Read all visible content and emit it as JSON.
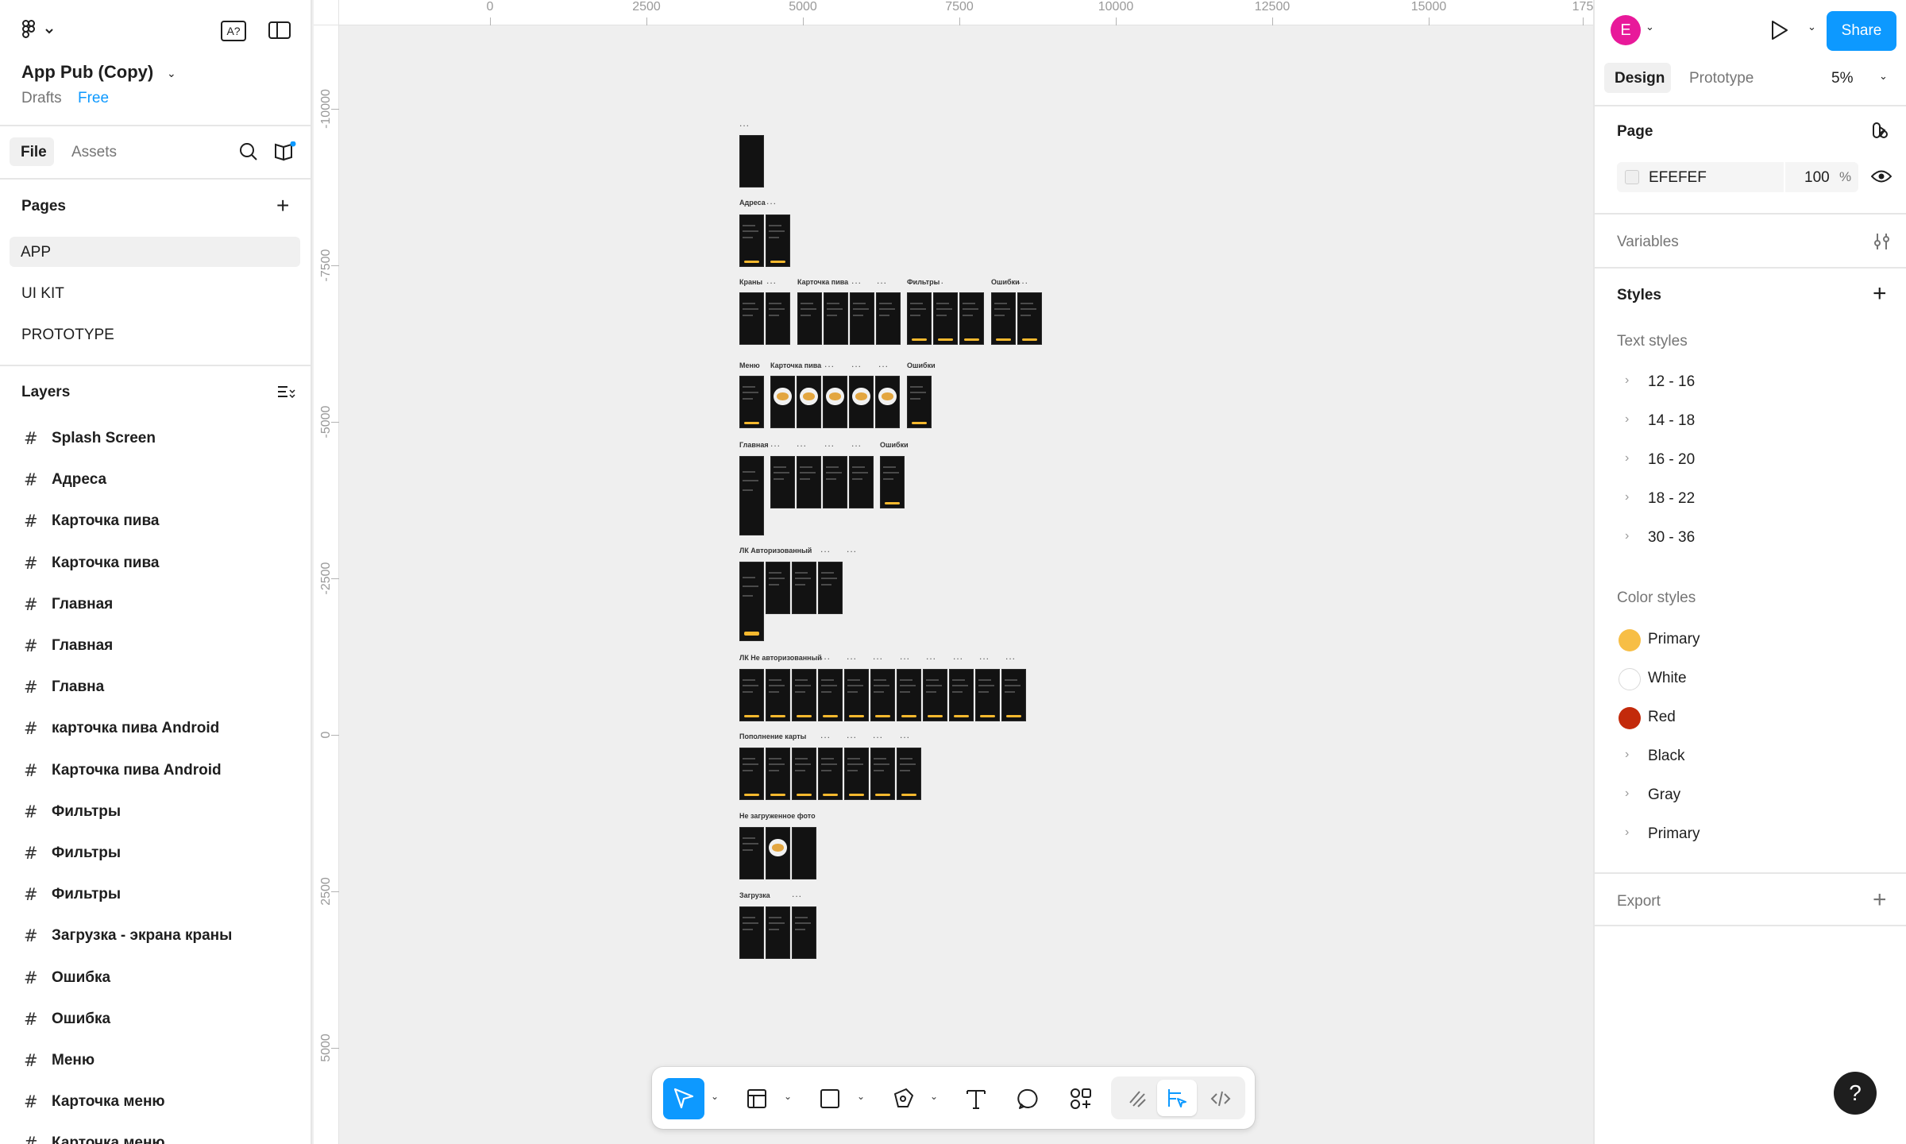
{
  "file": {
    "name": "App Pub (Copy)",
    "location": "Drafts",
    "plan": "Free"
  },
  "left_tabs": {
    "file": "File",
    "assets": "Assets"
  },
  "pages": {
    "heading": "Pages",
    "items": [
      "APP",
      "UI KIT",
      "PROTOTYPE"
    ],
    "selected": "APP"
  },
  "layers": {
    "heading": "Layers",
    "items": [
      "Splash Screen",
      "Адреса",
      "Карточка пива",
      "Карточка пива",
      "Главная",
      "Главная",
      "Главна",
      "карточка пива Android",
      "Карточка пива Android",
      "Фильтры",
      "Фильтры",
      "Фильтры",
      "Загрузка - экрана краны",
      "Ошибка",
      "Ошибка",
      "Меню",
      "Карточка меню",
      "Карточка меню"
    ]
  },
  "right": {
    "avatar_letter": "E",
    "share": "Share",
    "tabs": {
      "design": "Design",
      "prototype": "Prototype"
    },
    "zoom": "5%",
    "page_section": "Page",
    "page_color": "EFEFEF",
    "page_opacity": "100",
    "percent_sign": "%",
    "variables": "Variables",
    "styles": "Styles",
    "text_styles_heading": "Text styles",
    "text_styles": [
      "12 - 16",
      "14 - 18",
      "16 - 20",
      "18 - 22",
      "30 - 36"
    ],
    "color_styles_heading": "Color styles",
    "color_styles": [
      {
        "name": "Primary",
        "color": "#F7BE45",
        "type": "swatch"
      },
      {
        "name": "White",
        "color": "#FFFFFF",
        "type": "swatch"
      },
      {
        "name": "Red",
        "color": "#C32A0B",
        "type": "swatch"
      },
      {
        "name": "Black",
        "type": "group"
      },
      {
        "name": "Gray",
        "type": "group"
      },
      {
        "name": "Primary",
        "type": "group"
      }
    ],
    "export": "Export"
  },
  "ruler": {
    "h": [
      "0",
      "2500",
      "5000",
      "7500",
      "10000",
      "12500",
      "15000",
      "175"
    ],
    "v": [
      "-10000",
      "-7500",
      "-5000",
      "-2500",
      "0",
      "2500",
      "5000"
    ]
  },
  "canvas_labels": {
    "addresses": "Адреса",
    "taps": "Краны",
    "beer_card": "Карточка пива",
    "filters": "Фильтры",
    "errors": "Ошибки",
    "menu": "Меню",
    "main": "Главная",
    "lk_auth": "ЛК Авторизованный",
    "lk_unauth": "ЛК Не авторизованный",
    "card_topup": "Пополнение карты",
    "not_loaded_photo": "Не загруженное фото",
    "loading": "Загрузка",
    "dots": "..."
  },
  "colors": {
    "accent": "#0D99FF",
    "brand_yellow": "#F5B82E",
    "avatar": "#E8199A"
  },
  "help": "?"
}
